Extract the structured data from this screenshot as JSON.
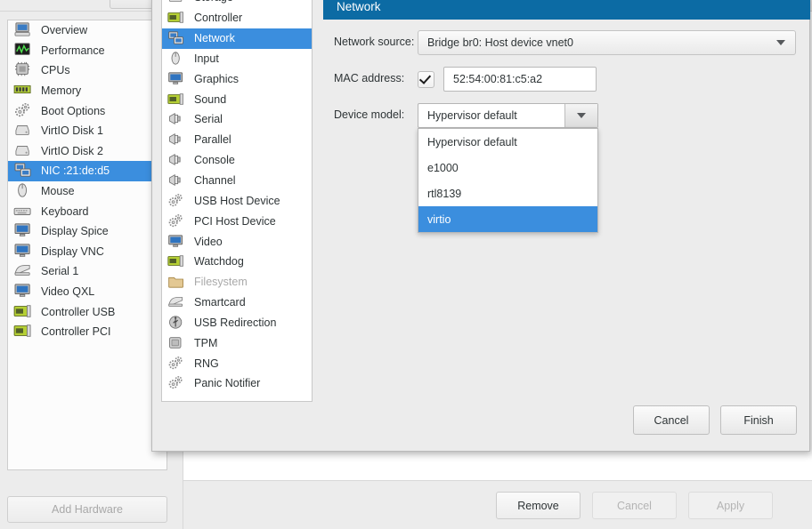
{
  "background_window": {
    "hardware_list": [
      {
        "label": "Overview",
        "icon": "computer-icon",
        "selected": false
      },
      {
        "label": "Performance",
        "icon": "performance-graph-icon",
        "selected": false
      },
      {
        "label": "CPUs",
        "icon": "cpu-chip-icon",
        "selected": false
      },
      {
        "label": "Memory",
        "icon": "memory-module-icon",
        "selected": false
      },
      {
        "label": "Boot Options",
        "icon": "gears-icon",
        "selected": false
      },
      {
        "label": "VirtIO Disk 1",
        "icon": "harddisk-icon",
        "selected": false
      },
      {
        "label": "VirtIO Disk 2",
        "icon": "harddisk-icon",
        "selected": false
      },
      {
        "label": "NIC :21:de:d5",
        "icon": "network-card-icon",
        "selected": true
      },
      {
        "label": "Mouse",
        "icon": "mouse-icon",
        "selected": false
      },
      {
        "label": "Keyboard",
        "icon": "keyboard-icon",
        "selected": false
      },
      {
        "label": "Display Spice",
        "icon": "display-icon",
        "selected": false
      },
      {
        "label": "Display VNC",
        "icon": "display-icon",
        "selected": false
      },
      {
        "label": "Serial 1",
        "icon": "serial-port-icon",
        "selected": false
      },
      {
        "label": "Video QXL",
        "icon": "display-icon",
        "selected": false
      },
      {
        "label": "Controller USB",
        "icon": "controller-card-icon",
        "selected": false
      },
      {
        "label": "Controller PCI",
        "icon": "controller-card-icon",
        "selected": false
      }
    ],
    "add_hardware_label": "Add Hardware",
    "footer_buttons": [
      {
        "label": "Remove",
        "enabled": true
      },
      {
        "label": "Cancel",
        "enabled": false
      },
      {
        "label": "Apply",
        "enabled": false
      }
    ]
  },
  "dialog": {
    "categories": [
      {
        "label": "Storage",
        "icon": "storage-disk-icon",
        "selected": false,
        "dimmed": false
      },
      {
        "label": "Controller",
        "icon": "controller-card-icon",
        "selected": false,
        "dimmed": false
      },
      {
        "label": "Network",
        "icon": "network-card-icon",
        "selected": true,
        "dimmed": false
      },
      {
        "label": "Input",
        "icon": "mouse-input-icon",
        "selected": false,
        "dimmed": false
      },
      {
        "label": "Graphics",
        "icon": "display-icon",
        "selected": false,
        "dimmed": false
      },
      {
        "label": "Sound",
        "icon": "sound-card-icon",
        "selected": false,
        "dimmed": false
      },
      {
        "label": "Serial",
        "icon": "serial-plug-icon",
        "selected": false,
        "dimmed": false
      },
      {
        "label": "Parallel",
        "icon": "serial-plug-icon",
        "selected": false,
        "dimmed": false
      },
      {
        "label": "Console",
        "icon": "serial-plug-icon",
        "selected": false,
        "dimmed": false
      },
      {
        "label": "Channel",
        "icon": "serial-plug-icon",
        "selected": false,
        "dimmed": false
      },
      {
        "label": "USB Host Device",
        "icon": "gears-icon",
        "selected": false,
        "dimmed": false
      },
      {
        "label": "PCI Host Device",
        "icon": "gears-icon",
        "selected": false,
        "dimmed": false
      },
      {
        "label": "Video",
        "icon": "display-icon",
        "selected": false,
        "dimmed": false
      },
      {
        "label": "Watchdog",
        "icon": "watchdog-card-icon",
        "selected": false,
        "dimmed": false
      },
      {
        "label": "Filesystem",
        "icon": "folder-icon",
        "selected": false,
        "dimmed": true
      },
      {
        "label": "Smartcard",
        "icon": "smartcard-icon",
        "selected": false,
        "dimmed": false
      },
      {
        "label": "USB Redirection",
        "icon": "usb-icon",
        "selected": false,
        "dimmed": false
      },
      {
        "label": "TPM",
        "icon": "tpm-chip-icon",
        "selected": false,
        "dimmed": false
      },
      {
        "label": "RNG",
        "icon": "gears-icon",
        "selected": false,
        "dimmed": false
      },
      {
        "label": "Panic Notifier",
        "icon": "gears-icon",
        "selected": false,
        "dimmed": false
      }
    ],
    "panel": {
      "title": "Network",
      "network_source": {
        "label": "Network source:",
        "value": "Bridge br0: Host device vnet0"
      },
      "mac_address": {
        "label": "MAC address:",
        "checked": true,
        "value": "52:54:00:81:c5:a2"
      },
      "device_model": {
        "label": "Device model:",
        "value": "Hypervisor default",
        "options": [
          {
            "label": "Hypervisor default",
            "highlighted": false
          },
          {
            "label": "e1000",
            "highlighted": false
          },
          {
            "label": "rtl8139",
            "highlighted": false
          },
          {
            "label": "virtio",
            "highlighted": true
          }
        ]
      }
    },
    "buttons": [
      {
        "label": "Cancel"
      },
      {
        "label": "Finish"
      }
    ]
  },
  "colors": {
    "header_blue": "#0c6ba4",
    "selection_blue": "#3b8ede",
    "panel_gray": "#ececec",
    "list_white": "#ffffff"
  }
}
